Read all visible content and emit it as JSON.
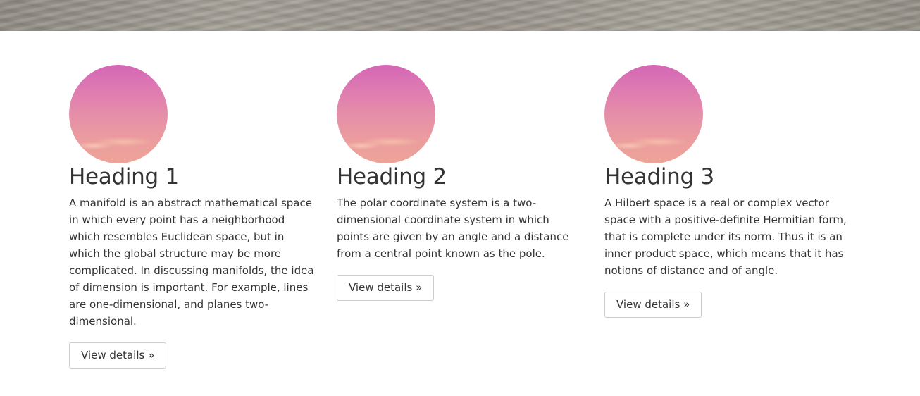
{
  "columns": [
    {
      "heading": "Heading 1",
      "text": "A manifold is an abstract mathematical space in which every point has a neighborhood which resembles Euclidean space, but in which the global structure may be more complicated. In discussing manifolds, the idea of dimension is important. For example, lines are one-dimensional, and planes two-dimensional.",
      "button": "View details »"
    },
    {
      "heading": "Heading 2",
      "text": "The polar coordinate system is a two-dimensional coordinate system in which points are given by an angle and a distance from a central point known as the pole.",
      "button": "View details »"
    },
    {
      "heading": "Heading 3",
      "text": "A Hilbert space is a real or complex vector space with a positive-definite Hermitian form, that is complete under its norm. Thus it is an inner product space, which means that it has notions of distance and of angle.",
      "button": "View details »"
    }
  ]
}
